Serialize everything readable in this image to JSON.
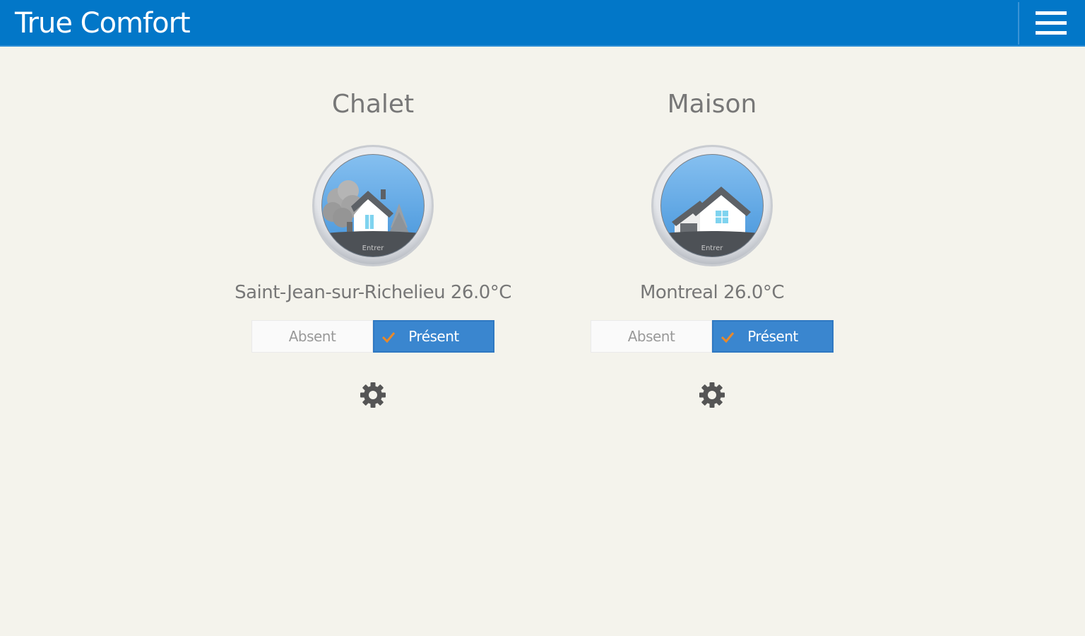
{
  "header": {
    "title": "True Comfort",
    "menu_icon": "hamburger-menu-icon",
    "background_color": "#0277c8"
  },
  "locations": [
    {
      "name": "Chalet",
      "city": "Saint-Jean-sur-Richelieu",
      "temperature": "26.0°C",
      "info": "Saint-Jean-sur-Richelieu 26.0°C",
      "house_icon": "chalet-house-icon",
      "house_caption": "Entrer",
      "mode_options": [
        "Absent",
        "Présent"
      ],
      "selected_mode": "Présent",
      "settings_icon": "gear-icon"
    },
    {
      "name": "Maison",
      "city": "Montreal",
      "temperature": "26.0°C",
      "info": "Montreal 26.0°C",
      "house_icon": "house-garage-icon",
      "house_caption": "Entrer",
      "mode_options": [
        "Absent",
        "Présent"
      ],
      "selected_mode": "Présent",
      "settings_icon": "gear-icon"
    }
  ],
  "colors": {
    "accent": "#3a86cf",
    "check_mark": "#e8892b",
    "page_background": "#f4f3ec"
  }
}
